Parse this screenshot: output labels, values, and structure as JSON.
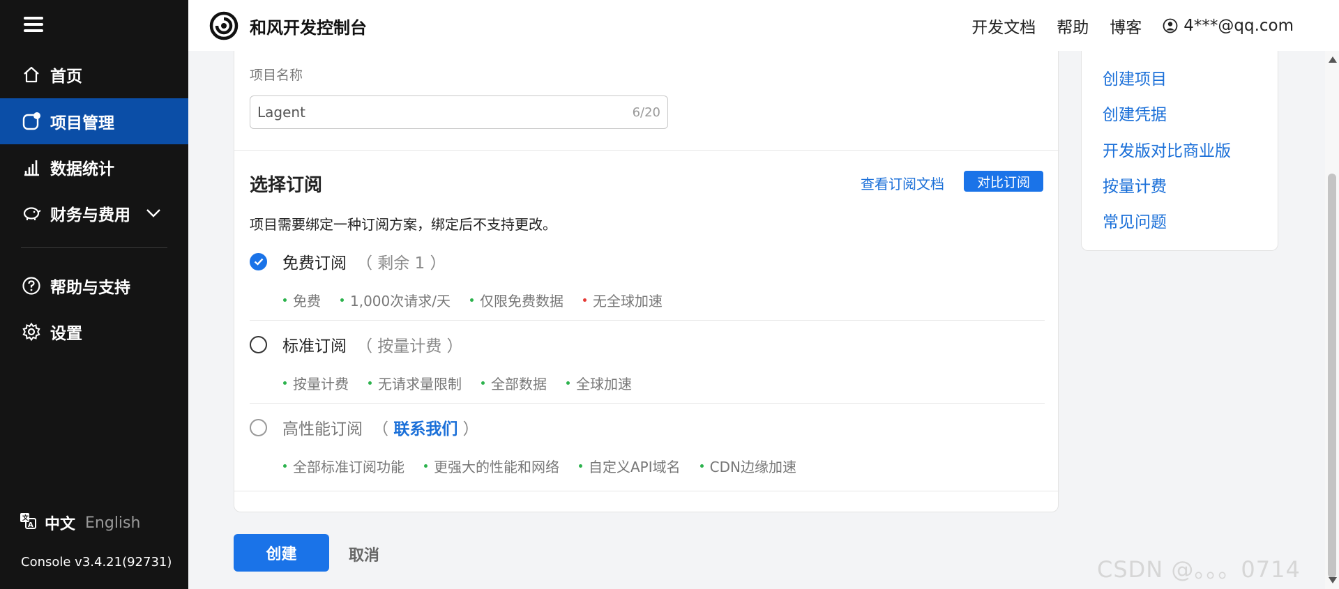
{
  "sidebar": {
    "items": [
      {
        "label": "首页",
        "icon": "home-icon"
      },
      {
        "label": "项目管理",
        "icon": "project-icon",
        "active": true
      },
      {
        "label": "数据统计",
        "icon": "bar-chart-icon"
      },
      {
        "label": "财务与费用",
        "icon": "piggy-bank-icon"
      },
      {
        "label": "帮助与支持",
        "icon": "help-icon"
      },
      {
        "label": "设置",
        "icon": "gear-icon"
      }
    ],
    "lang_zh": "中文",
    "lang_en": "English",
    "version": "Console v3.4.21(92731)"
  },
  "header": {
    "brand": "和风开发控制台",
    "links": [
      "开发文档",
      "帮助",
      "博客"
    ],
    "user": "4***@qq.com"
  },
  "form": {
    "name_label": "项目名称",
    "name_value": "Lagent",
    "name_count": "6/20",
    "subscription_title": "选择订阅",
    "doc_link": "查看订阅文档",
    "compare_button": "对比订阅",
    "hint": "项目需要绑定一种订阅方案，绑定后不支持更改。",
    "plans": [
      {
        "name": "免费订阅",
        "paren": "（ 剩余 1 ）",
        "selected": true,
        "features": [
          {
            "text": "免费",
            "color": "#2bb24c"
          },
          {
            "text": "1,000次请求/天",
            "color": "#2bb24c"
          },
          {
            "text": "仅限免费数据",
            "color": "#2bb24c"
          },
          {
            "text": "无全球加速",
            "color": "#e53935"
          }
        ]
      },
      {
        "name": "标准订阅",
        "paren": "（ 按量计费 ）",
        "selected": false,
        "features": [
          {
            "text": "按量计费",
            "color": "#2bb24c"
          },
          {
            "text": "无请求量限制",
            "color": "#2bb24c"
          },
          {
            "text": "全部数据",
            "color": "#2bb24c"
          },
          {
            "text": "全球加速",
            "color": "#2bb24c"
          }
        ]
      },
      {
        "name": "高性能订阅",
        "paren_open": "（ ",
        "paren_link": "联系我们",
        "paren_close": " ）",
        "selected": false,
        "features": [
          {
            "text": "全部标准订阅功能",
            "color": "#2bb24c"
          },
          {
            "text": "更强大的性能和网络",
            "color": "#2bb24c"
          },
          {
            "text": "自定义API域名",
            "color": "#2bb24c"
          },
          {
            "text": "CDN边缘加速",
            "color": "#2bb24c"
          }
        ]
      }
    ],
    "create_button": "创建",
    "cancel_button": "取消"
  },
  "side_panel": {
    "links": [
      "创建项目",
      "创建凭据",
      "开发版对比商业版",
      "按量计费",
      "常见问题"
    ]
  },
  "watermark": "CSDN @。。。0714",
  "colors": {
    "accent": "#1a73e8",
    "sidebar_bg": "#141414",
    "active_nav": "#0b4ea7"
  }
}
